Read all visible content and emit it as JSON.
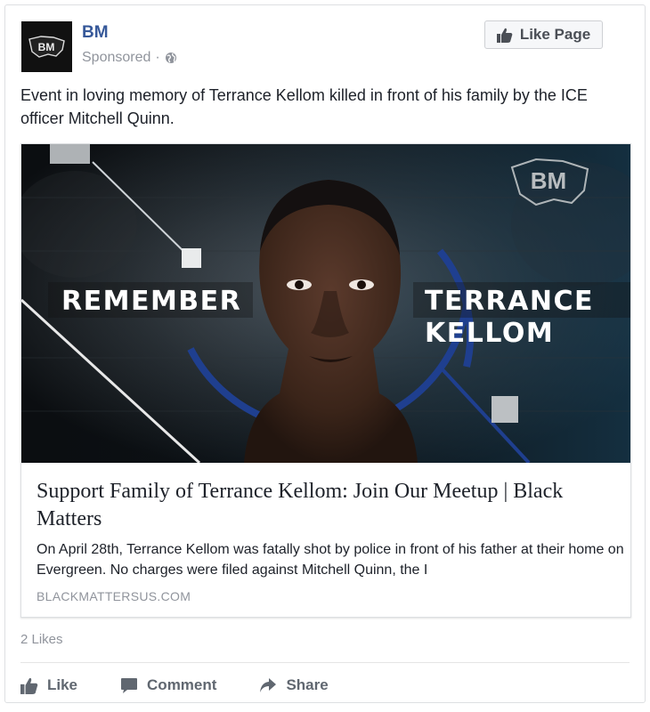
{
  "post": {
    "page_name": "BM",
    "sponsored_label": "Sponsored",
    "separator": "·",
    "like_page_label": "Like Page",
    "text": "Event in loving memory of Terrance Kellom killed in front of his family by the ICE officer Mitchell Quinn.",
    "avatar_logo_text": "BM"
  },
  "link": {
    "image_logo_text": "BM",
    "image_text_left": "REMEMBER",
    "image_text_right_1": "TERRANCE",
    "image_text_right_2": "KELLOM",
    "title": "Support Family of Terrance Kellom: Join Our Meetup | Black Matters",
    "description": "On April 28th, Terrance Kellom was fatally shot by police in front of his father at their home on Evergreen. No charges were filed against Mitchell Quinn, the I",
    "domain": "BLACKMATTERSUS.COM"
  },
  "footer": {
    "likes_count": "2 Likes",
    "like_label": "Like",
    "comment_label": "Comment",
    "share_label": "Share"
  },
  "icons": {
    "globe": "globe-icon",
    "thumbs_up": "thumbs-up-icon",
    "comment": "comment-icon",
    "share": "share-arrow-icon"
  },
  "colors": {
    "page_name": "#365899",
    "meta_gray": "#90949c",
    "text": "#1d2129",
    "hero_accent_blue": "#1f3f8f"
  }
}
